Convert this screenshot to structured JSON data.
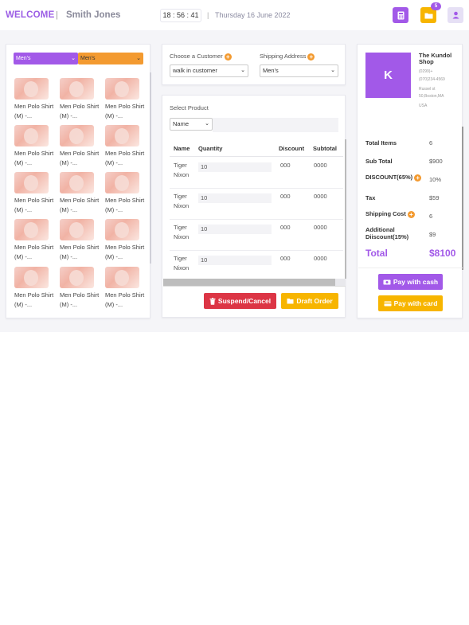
{
  "header": {
    "welcome": "WELCOME",
    "separator": "|",
    "user_name": "Smith Jones",
    "time": "18 : 56 : 41",
    "date": "Thursday 16 June 2022",
    "folder_badge": "5",
    "icons": [
      "calculator-icon",
      "folder-icon",
      "user-icon"
    ],
    "accent_purple": "#a259e8",
    "accent_yellow": "#f7b500"
  },
  "filters": {
    "category_primary": "Men's",
    "category_secondary": "Men's"
  },
  "products": [
    {
      "name": "Men Polo Shirt (M) -..."
    },
    {
      "name": "Men Polo Shirt (M) -..."
    },
    {
      "name": "Men Polo Shirt (M) -..."
    },
    {
      "name": "Men Polo Shirt (M) -..."
    },
    {
      "name": "Men Polo Shirt (M) -..."
    },
    {
      "name": "Men Polo Shirt (M) -..."
    },
    {
      "name": "Men Polo Shirt (M) -..."
    },
    {
      "name": "Men Polo Shirt (M) -..."
    },
    {
      "name": "Men Polo Shirt (M) -..."
    },
    {
      "name": "Men Polo Shirt (M) -..."
    },
    {
      "name": "Men Polo Shirt (M) -..."
    },
    {
      "name": "Men Polo Shirt (M) -..."
    },
    {
      "name": "Men Polo Shirt (M) -..."
    },
    {
      "name": "Men Polo Shirt (M) -..."
    },
    {
      "name": "Men Polo Shirt (M) -..."
    }
  ],
  "customer": {
    "choose_label": "Choose a Customer",
    "customer_value": "walk in customer",
    "shipping_label": "Shipping Address",
    "shipping_value": "Men's"
  },
  "product_table": {
    "select_label": "Select Product",
    "search_by": "Name",
    "columns": [
      "Name",
      "Quantity",
      "Discount",
      "Subtotal"
    ],
    "rows": [
      {
        "name": "Tiger Nixon",
        "quantity": "10",
        "discount": "000",
        "subtotal": "0000"
      },
      {
        "name": "Tiger Nixon",
        "quantity": "10",
        "discount": "000",
        "subtotal": "0000"
      },
      {
        "name": "Tiger Nixon",
        "quantity": "10",
        "discount": "000",
        "subtotal": "0000"
      },
      {
        "name": "Tiger Nixon",
        "quantity": "10",
        "discount": "000",
        "subtotal": "0000"
      }
    ],
    "suspend_label": "Suspend/Cancel",
    "draft_label": "Draft Order"
  },
  "summary": {
    "avatar_letter": "K",
    "shop_name": "The Kundol Shop",
    "phone1": "(0299)+",
    "phone2": "(070)234-4569",
    "address1": "Russel st",
    "address2": "50,Boston,MA",
    "country": "USA",
    "total_items_label": "Total Items",
    "total_items": "6",
    "sub_total_label": "Sub Total",
    "sub_total": "$900",
    "discount_label": "DISCOUNT(65%)",
    "discount": "10%",
    "tax_label": "Tax",
    "tax": "$59",
    "shipping_label": "Shipping Cost",
    "shipping": "6",
    "additional_label_1": "Additional",
    "additional_label_2": "Diiscount(15%)",
    "additional": "$9",
    "total_label": "Total",
    "total": "$8100",
    "pay_cash": "Pay with cash",
    "pay_card": "Pay with card"
  }
}
